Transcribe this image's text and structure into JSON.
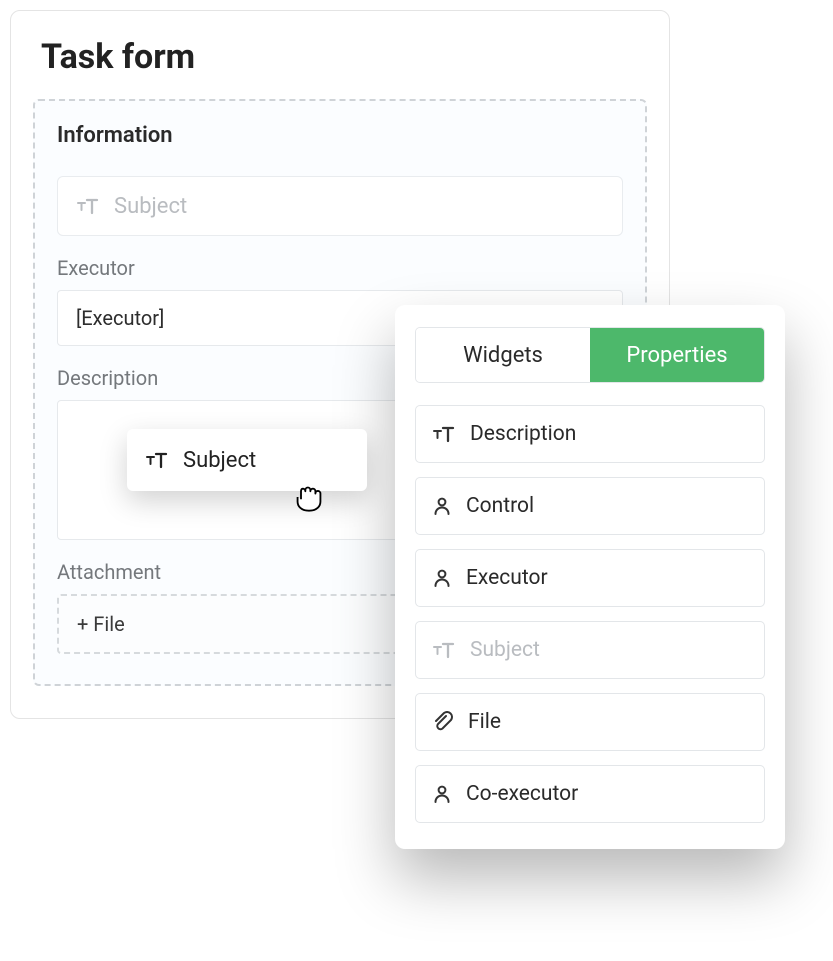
{
  "form": {
    "title": "Task form",
    "infoSection": "Information",
    "subjectPlaceholder": "Subject",
    "executorLabel": "Executor",
    "executorValue": "[Executor]",
    "descriptionLabel": "Description",
    "attachmentLabel": "Attachment",
    "addFile": "+ File"
  },
  "drag": {
    "label": "Subject"
  },
  "panel": {
    "tabs": {
      "widgets": "Widgets",
      "properties": "Properties"
    },
    "items": {
      "description": "Description",
      "control": "Control",
      "executor": "Executor",
      "subject": "Subject",
      "file": "File",
      "coexecutor": "Co-executor"
    }
  },
  "colors": {
    "accent": "#4db86b"
  }
}
